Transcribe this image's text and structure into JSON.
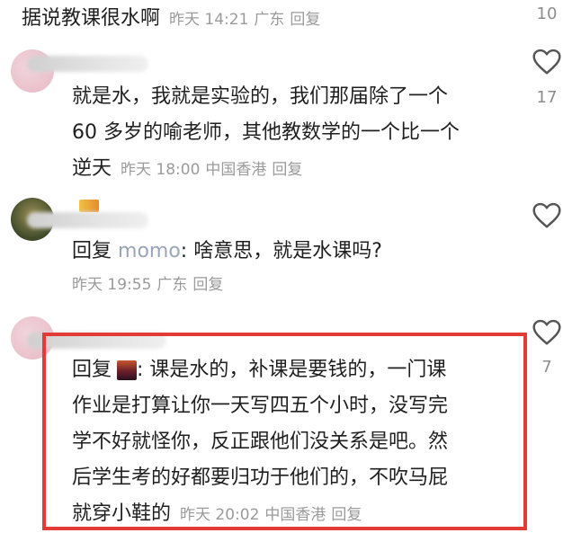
{
  "comments": [
    {
      "text": "据说教课很水啊",
      "time": "昨天 14:21",
      "location": "广东",
      "reply_label": "回复",
      "likes": "10"
    },
    {
      "text_lines": [
        "就是水，我就是实验的，我们那届除了一个",
        "60 多岁的喻老师，其他教数学的一个比一个",
        "逆天"
      ],
      "time": "昨天 18:00",
      "location": "中国香港",
      "reply_label": "回复",
      "likes": "17"
    },
    {
      "reply_prefix": "回复",
      "reply_to": "momo",
      "text": ": 啥意思，就是水课吗?",
      "time": "昨天 19:55",
      "location": "广东",
      "reply_label": "回复"
    },
    {
      "reply_prefix": "回复",
      "text_lines": [
        ": 课是水的，补课是要钱的，一门课",
        "作业是打算让你一天写四五个小时，没写完",
        "学不好就怪你，反正跟他们没关系是吧。然",
        "后学生考的好都要归功于他们的，不吹马屁",
        "就穿小鞋的"
      ],
      "time": "昨天 20:02",
      "location": "中国香港",
      "reply_label": "回复",
      "likes": "7"
    }
  ],
  "colors": {
    "highlight": "#e33b36",
    "meta": "#9a9a9a",
    "reply_name": "#9aa4b8"
  },
  "icons": {
    "like": "heart-outline-icon"
  }
}
